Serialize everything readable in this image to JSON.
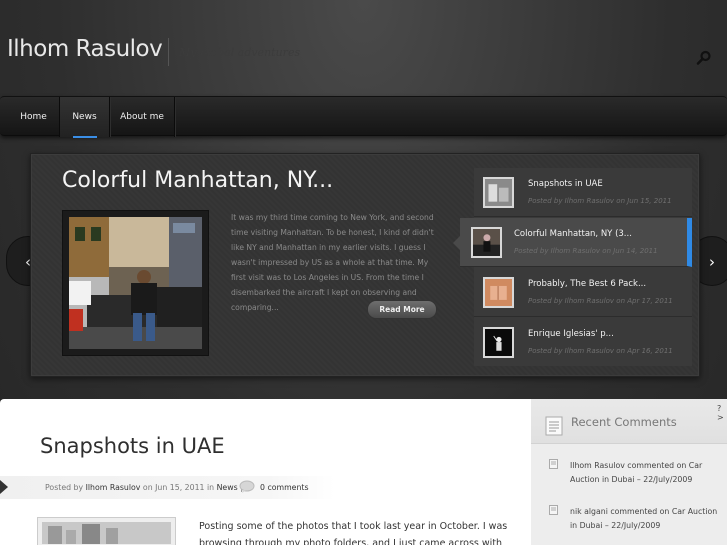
{
  "header": {
    "site_title": "Ilhom Rasulov",
    "tagline": "My global adventures"
  },
  "nav": {
    "items": [
      {
        "label": "Home"
      },
      {
        "label": "News"
      },
      {
        "label": "About me"
      }
    ],
    "active": "News"
  },
  "featured": {
    "title": "Colorful Manhattan, NY...",
    "excerpt": "It was my third time coming to New York, and second time visiting Manhattan. To be honest, I kind of didn't like NY and Manhattan in my earlier visits. I guess I wasn't impressed by US as a whole at that time. My first visit was to Los Angeles in US. From the time I disembarked the aircraft I kept on observing and comparing...",
    "read_more": "Read More",
    "slides": [
      {
        "title": "Snapshots in UAE",
        "meta": "Posted by Ilhom Rasulov on Jun 15, 2011"
      },
      {
        "title": "Colorful Manhattan, NY (3...",
        "meta": "Posted by Ilhom Rasulov on Jun 14, 2011"
      },
      {
        "title": "Probably, The Best 6 Pack...",
        "meta": "Posted by Ilhom Rasulov on Apr 17, 2011"
      },
      {
        "title": "Enrique Iglesias' p...",
        "meta": "Posted by Ilhom Rasulov on Apr 16, 2011"
      }
    ],
    "prev_arrow": "‹",
    "next_arrow": "›"
  },
  "post": {
    "title": "Snapshots in UAE",
    "meta": {
      "posted_by": "Posted by",
      "author": "Ilhom Rasulov",
      "on": "on Jun 15, 2011 in",
      "category": "News",
      "sep": "|",
      "comments": "0 comments"
    },
    "excerpt": "Posting some of the photos that I took last year in October. I was browsing through my photo folders, and I just came across with"
  },
  "sidebar": {
    "title": "Recent Comments",
    "corner": "?\n>",
    "comments": [
      {
        "text": "Ilhom Rasulov commented on Car Auction in Dubai – 22/July/2009"
      },
      {
        "text": "nik algani commented on Car Auction in Dubai – 22/July/2009"
      }
    ]
  },
  "colors": {
    "accent": "#2f8ae6",
    "background": "#2c2c2c"
  }
}
